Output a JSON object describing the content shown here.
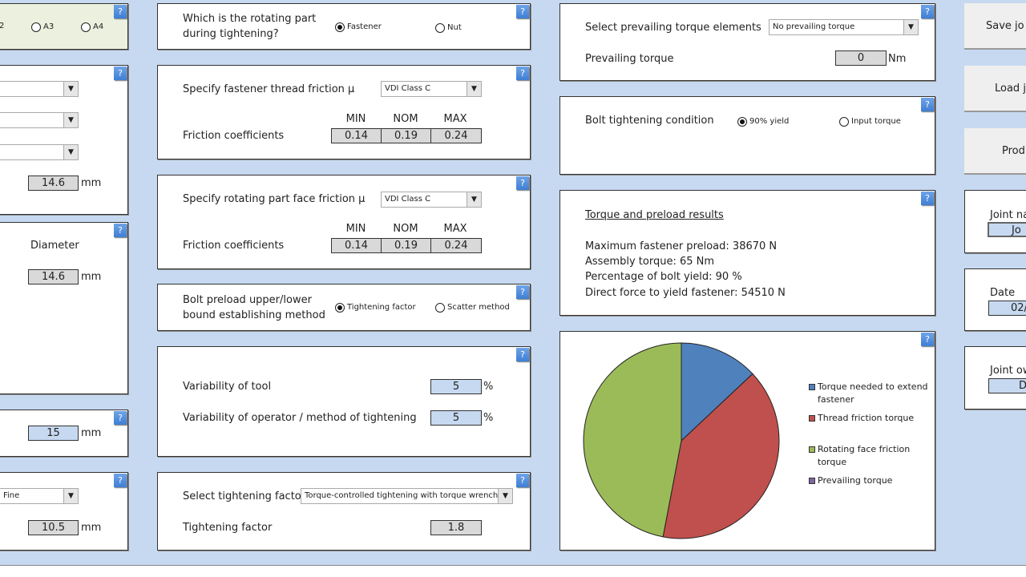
{
  "left": {
    "a2_partial": "2",
    "a3": "A3",
    "a4": "A4",
    "length1": "14.6",
    "unit": "mm",
    "diameter_label": "Diameter",
    "diameter": "14.6",
    "value15": "15",
    "thread_select": "Fine",
    "value105": "10.5"
  },
  "rotating": {
    "question": "Which is the rotating part during tightening?",
    "opt1": "Fastener",
    "opt2": "Nut",
    "selected": "Fastener"
  },
  "thread_friction": {
    "label": "Specify fastener thread friction µ",
    "select": "VDI Class C",
    "coef_label": "Friction coefficients",
    "headers": [
      "MIN",
      "NOM",
      "MAX"
    ],
    "values": [
      "0.14",
      "0.19",
      "0.24"
    ]
  },
  "face_friction": {
    "label": "Specify rotating part face friction µ",
    "select": "VDI Class C",
    "coef_label": "Friction coefficients",
    "headers": [
      "MIN",
      "NOM",
      "MAX"
    ],
    "values": [
      "0.14",
      "0.19",
      "0.24"
    ]
  },
  "preload_method": {
    "label": "Bolt preload upper/lower bound establishing method",
    "opt1": "Tightening factor",
    "opt2": "Scatter method",
    "selected": "Tightening factor"
  },
  "variability": {
    "tool_label": "Variability of tool",
    "tool": "5",
    "operator_label": "Variability of operator / method of tightening",
    "operator": "5",
    "unit": "%"
  },
  "tightening": {
    "select_label": "Select tightening factor",
    "select": "Torque-controlled tightening with torque wrench",
    "factor_label": "Tightening factor",
    "factor": "1.8"
  },
  "prevailing": {
    "label": "Select prevailing torque elements",
    "select": "No prevailing torque",
    "torque_label": "Prevailing torque",
    "torque": "0",
    "unit": "Nm"
  },
  "condition": {
    "label": "Bolt tightening condition",
    "opt1": "90% yield",
    "opt2": "Input torque",
    "selected": "90% yield"
  },
  "results": {
    "title": "Torque and preload results",
    "lines": [
      "Maximum fastener preload: 38670 N",
      "Assembly torque: 65 Nm",
      "Percentage of bolt yield: 90 %",
      "Direct force to yield fastener: 54510 N"
    ]
  },
  "chart_data": {
    "type": "pie",
    "series": [
      {
        "name": "Torque needed to extend fastener",
        "value": 13,
        "color": "#4f81bd"
      },
      {
        "name": "Thread friction torque",
        "value": 40,
        "color": "#c0504d"
      },
      {
        "name": "Rotating face friction torque",
        "value": 47,
        "color": "#9bbb59"
      },
      {
        "name": "Prevailing torque",
        "value": 0,
        "color": "#8064a2"
      }
    ],
    "legend": "right"
  },
  "right": {
    "save": "Save jo",
    "load": "Load jo",
    "produce": "Produ",
    "joint_name_label": "Joint na",
    "joint_name": "Jo",
    "date_label": "Date",
    "date": "02/",
    "owner_label": "Joint ow",
    "owner": "D."
  },
  "help": "?"
}
